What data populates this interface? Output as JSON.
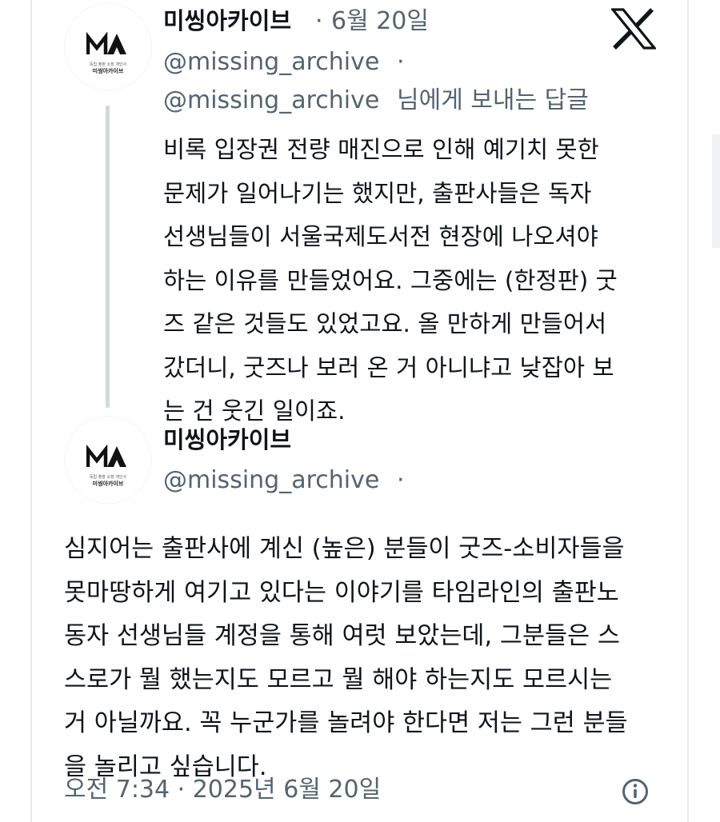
{
  "reply_tweet": {
    "display_name": "미씽아카이브",
    "separator": "·",
    "date": "6월 20일",
    "handle": "@missing_archive",
    "handle_suffix": "·",
    "reply_context_handle": "@missing_archive",
    "reply_context_text": "님에게 보내는 답글",
    "body_lines": [
      "비록 입장권 전량 매진으로 인해 예기치 못한",
      "문제가 일어나기는 했지만, 출판사들은 독자",
      "선생님들이 서울국제도서전 현장에 나오셔야",
      "하는 이유를 만들었어요. 그중에는 (한정판) 굿",
      "즈 같은 것들도 있었고요. 올 만하게 만들어서",
      "갔더니, 굿즈나 보러 온 거 아니냐고 낮잡아 보",
      "는 건 웃긴 일이죠."
    ]
  },
  "main_tweet": {
    "display_name": "미씽아카이브",
    "handle": "@missing_archive",
    "handle_suffix": "·",
    "body_lines": [
      "심지어는 출판사에 계신 (높은) 분들이 굿즈-소비자들을",
      "못마땅하게 여기고 있다는 이야기를 타임라인의 출판노",
      "동자 선생님들 계정을 통해 여럿 보았는데, 그분들은 스",
      "스로가 뭘 했는지도 모르고 뭘 해야 하는지도 모르시는",
      "거 아닐까요. 꼭 누군가를 놀려야 한다면 저는 그런 분들",
      "을 놀리고 싶습니다."
    ],
    "timestamp": "오전 7:34 · 2025년 6월 20일"
  },
  "avatar": {
    "logo_text_small": "독립 출판 소장 개인사",
    "logo_text_main": "미씽아카이브"
  },
  "icons": {
    "brand": "x-logo-icon",
    "info": "info-icon"
  },
  "colors": {
    "text": "#0f1419",
    "secondary_text": "#536471",
    "thread_line": "#cfd9de"
  }
}
